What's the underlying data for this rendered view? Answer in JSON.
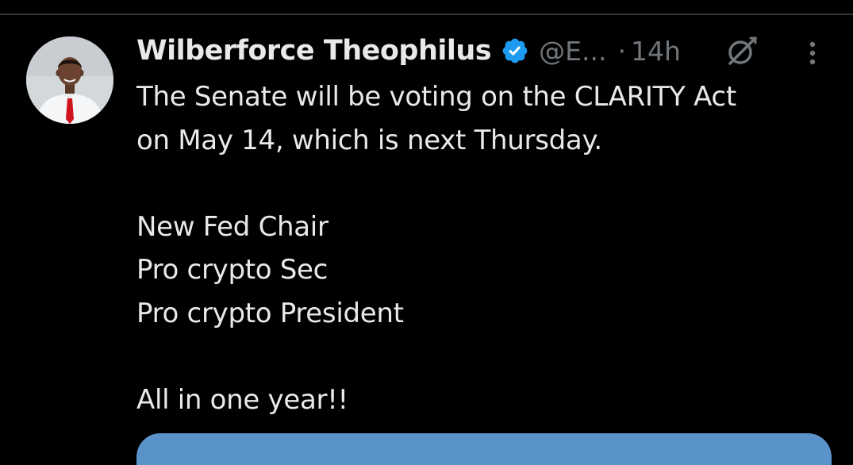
{
  "tweet": {
    "author": {
      "name": "Wilberforce Theophilus",
      "handle": "@E...",
      "verified": true,
      "verified_color": "#1d9bf0"
    },
    "separator": "·",
    "timestamp": "14h",
    "icons": {
      "grok": "grok-icon",
      "more": "more-options-icon",
      "verified": "verified-badge-icon"
    },
    "body": {
      "line1": "The Senate will be voting on the CLARITY Act",
      "line2": "on May 14, which is next Thursday.",
      "line3": "New Fed Chair",
      "line4": "Pro crypto Sec",
      "line5": "Pro crypto President",
      "line6": "All in one year!!"
    }
  },
  "theme": {
    "background": "#000000",
    "text_primary": "#e7e9ea",
    "text_secondary": "#71767b",
    "divider": "#2f3336",
    "card_accent": "#5a93c9"
  }
}
